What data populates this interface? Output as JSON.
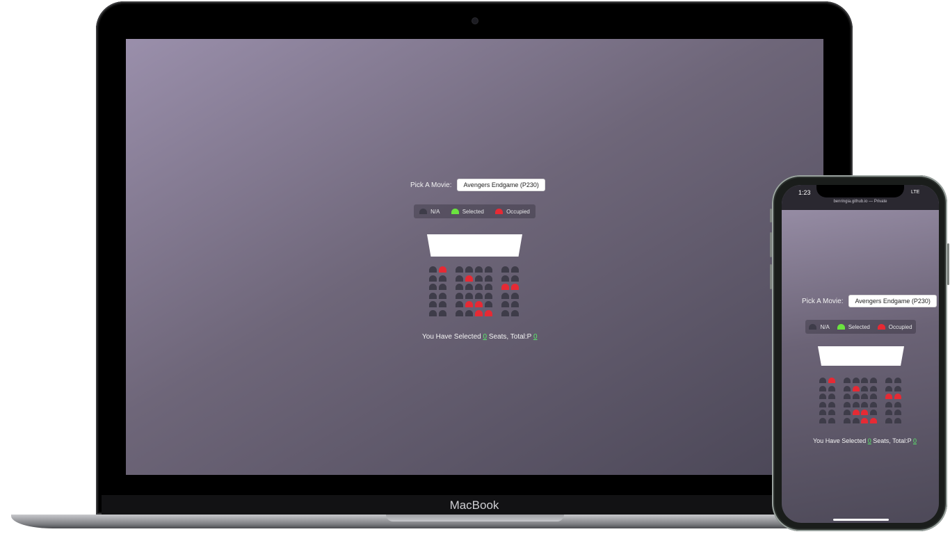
{
  "laptop": {
    "brand": "MacBook"
  },
  "app": {
    "movie_label": "Pick A Movie:",
    "selected_movie": "Avengers Endgame (P230)",
    "legend": {
      "na_label": "N/A",
      "selected_label": "Selected",
      "occupied_label": "Occupied"
    },
    "summary": {
      "prefix": "You Have Selected ",
      "count": "0",
      "middle": " Seats, Total:P ",
      "total": "0"
    },
    "seats": {
      "rows": 6,
      "cols": 8,
      "occupied": [
        [
          0,
          1
        ],
        [
          1,
          3
        ],
        [
          2,
          6
        ],
        [
          2,
          7
        ],
        [
          4,
          3
        ],
        [
          4,
          4
        ],
        [
          5,
          4
        ],
        [
          5,
          5
        ]
      ]
    },
    "colors": {
      "na": "#3e3c49",
      "selected": "#6be33f",
      "occupied": "#e62a34"
    }
  },
  "phone": {
    "time": "1:23",
    "signal": "LTE",
    "url": "benringia.github.io — Private"
  }
}
